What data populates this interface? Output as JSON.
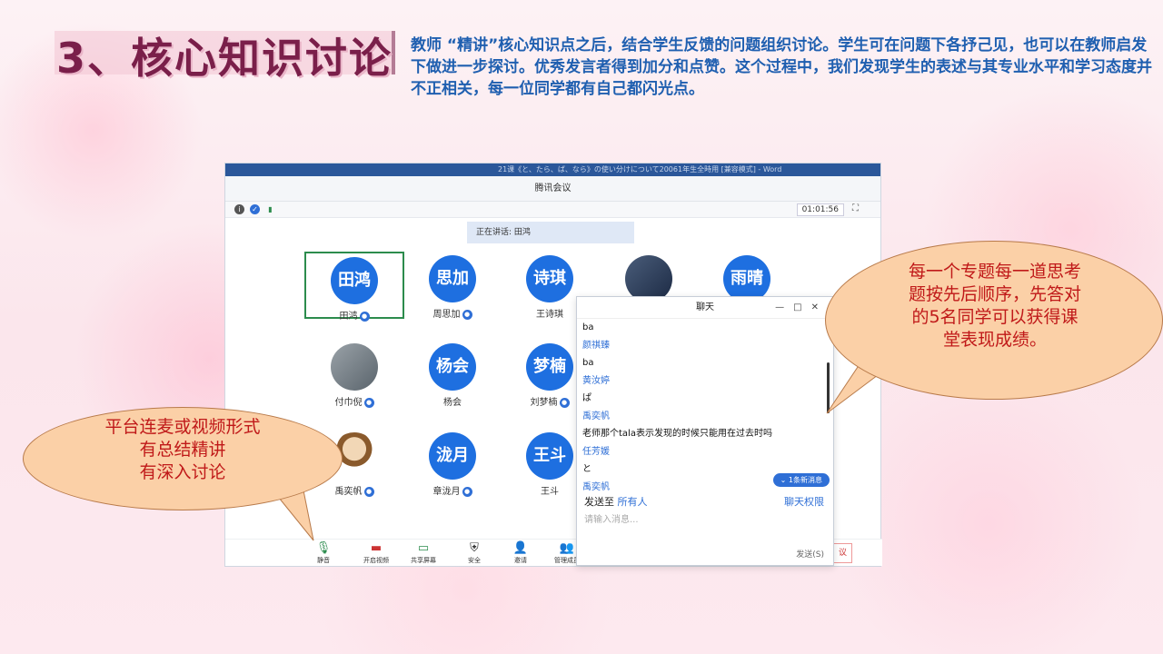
{
  "slide": {
    "title": "3、核心知识讨论",
    "intro": "教师 “精讲”核心知识点之后，结合学生反馈的问题组织讨论。学生可在问题下各抒己见，也可以在教师启发下做进一步探讨。优秀发言者得到加分和点赞。这个过程中，我们发现学生的表述与其专业水平和学习态度并不正相关，每一位同学都有自己都闪光点。"
  },
  "meeting": {
    "word_title": "21课《と、たら、ば、なら》の使い分けについて20061年生全時用 [兼容模式] - Word",
    "app_title": "腾讯会议",
    "timer": "01:01:56",
    "speaking": "正在讲话: 田鸿",
    "participants": [
      {
        "avatar": "田鸿",
        "name": "田鸿"
      },
      {
        "avatar": "思加",
        "name": "周思加"
      },
      {
        "avatar": "诗琪",
        "name": "王诗琪"
      },
      {
        "avatar": "",
        "name": ""
      },
      {
        "avatar": "雨晴",
        "name": ""
      },
      {
        "avatar": "",
        "name": "付巾倪"
      },
      {
        "avatar": "杨会",
        "name": "杨会"
      },
      {
        "avatar": "梦楠",
        "name": "刘梦楠"
      },
      {
        "avatar": "",
        "name": "禹奕帆"
      },
      {
        "avatar": "泷月",
        "name": "章泷月"
      },
      {
        "avatar": "王斗",
        "name": "王斗"
      }
    ],
    "toolbar": [
      "静音",
      "开启视频",
      "共享屏幕",
      "安全",
      "邀请",
      "管理成员"
    ],
    "end_button": "议"
  },
  "chat": {
    "title": "聊天",
    "messages": [
      {
        "type": "text",
        "value": "ba"
      },
      {
        "type": "name",
        "value": "颜祺臻"
      },
      {
        "type": "text",
        "value": "ba"
      },
      {
        "type": "name",
        "value": "黄汝婷"
      },
      {
        "type": "text",
        "value": "ぱ"
      },
      {
        "type": "name",
        "value": "禹奕帆"
      },
      {
        "type": "text",
        "value": "老师那个tala表示发现的时候只能用在过去时吗"
      },
      {
        "type": "name",
        "value": "任芳媛"
      },
      {
        "type": "text",
        "value": "と"
      },
      {
        "type": "name",
        "value": "禹奕帆"
      }
    ],
    "new_message": "1条新消息",
    "send_to_label": "发送至",
    "send_to_value": "所有人",
    "permission": "聊天权限",
    "input_placeholder": "请输入消息...",
    "send_button": "发送(S)"
  },
  "callouts": {
    "left": [
      "平台连麦或视频形式",
      "有总结精讲",
      "有深入讨论"
    ],
    "right": [
      "每一个专题每一道思考",
      "题按先后顺序，先答对",
      "的5名同学可以获得课",
      "堂表现成绩。"
    ]
  }
}
